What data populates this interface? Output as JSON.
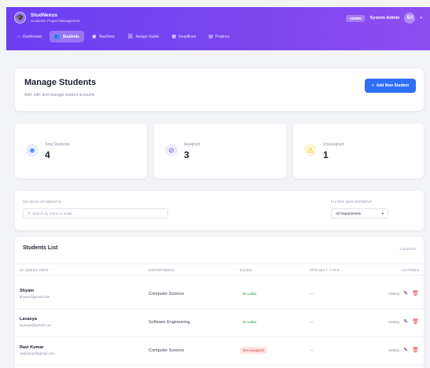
{
  "header": {
    "brand_title": "StudNexus",
    "brand_subtitle": "Academic Project Management",
    "role_badge": "ADMIN",
    "user_name": "System Admin",
    "avatar_initial": "SA",
    "nav": [
      {
        "label": "Dashboard",
        "icon": "home-icon",
        "active": false
      },
      {
        "label": "Students",
        "icon": "users-icon",
        "active": true
      },
      {
        "label": "Teachers",
        "icon": "teacher-icon",
        "active": false
      },
      {
        "label": "Assign Guide",
        "icon": "link-icon",
        "active": false
      },
      {
        "label": "Deadlines",
        "icon": "calendar-icon",
        "active": false
      },
      {
        "label": "Projects",
        "icon": "folder-icon",
        "active": false
      }
    ]
  },
  "manage": {
    "title": "Manage Students",
    "subtitle": "Add, edit, and manage student accounts",
    "add_button": "Add New Student"
  },
  "stats": [
    {
      "label": "Total Students",
      "value": "4",
      "icon": "user-icon",
      "color": "#4f7df5",
      "bg": "#e8eeff"
    },
    {
      "label": "Assigned",
      "value": "3",
      "icon": "check-circle-icon",
      "color": "#7a5cf0",
      "bg": "#efeafe"
    },
    {
      "label": "Unassigned",
      "value": "1",
      "icon": "warning-icon",
      "color": "#e6b400",
      "bg": "#fff6d6"
    }
  ],
  "filters": {
    "search_label": "Search Students",
    "search_placeholder": "Search by name or email...",
    "dept_label": "Filter Department",
    "dept_value": "All Departments"
  },
  "list": {
    "title": "Students List",
    "count": "4 students",
    "columns": [
      "Student Info",
      "Department",
      "Guide",
      "Project Title",
      "Actions"
    ],
    "rows": [
      {
        "name": "Shyam",
        "email": "shyam@gmail.com",
        "dept": "Computer Science",
        "status": "Dr.Latha",
        "assigned": true,
        "project": "—",
        "view": "History"
      },
      {
        "name": "Lavanya",
        "email": "lavanya@gmail.com",
        "dept": "Software Engineering",
        "status": "Dr.Latha",
        "assigned": true,
        "project": "—",
        "view": "History"
      },
      {
        "name": "Ravi Kumar",
        "email": "ravikumar@gmail.com",
        "dept": "Computer Science",
        "status": "Not Assigned",
        "assigned": false,
        "project": "—",
        "view": "History"
      }
    ]
  },
  "colors": {
    "accent": "#2f6ff3",
    "header_start": "#6b3ff2",
    "header_end": "#8e4ff0"
  }
}
